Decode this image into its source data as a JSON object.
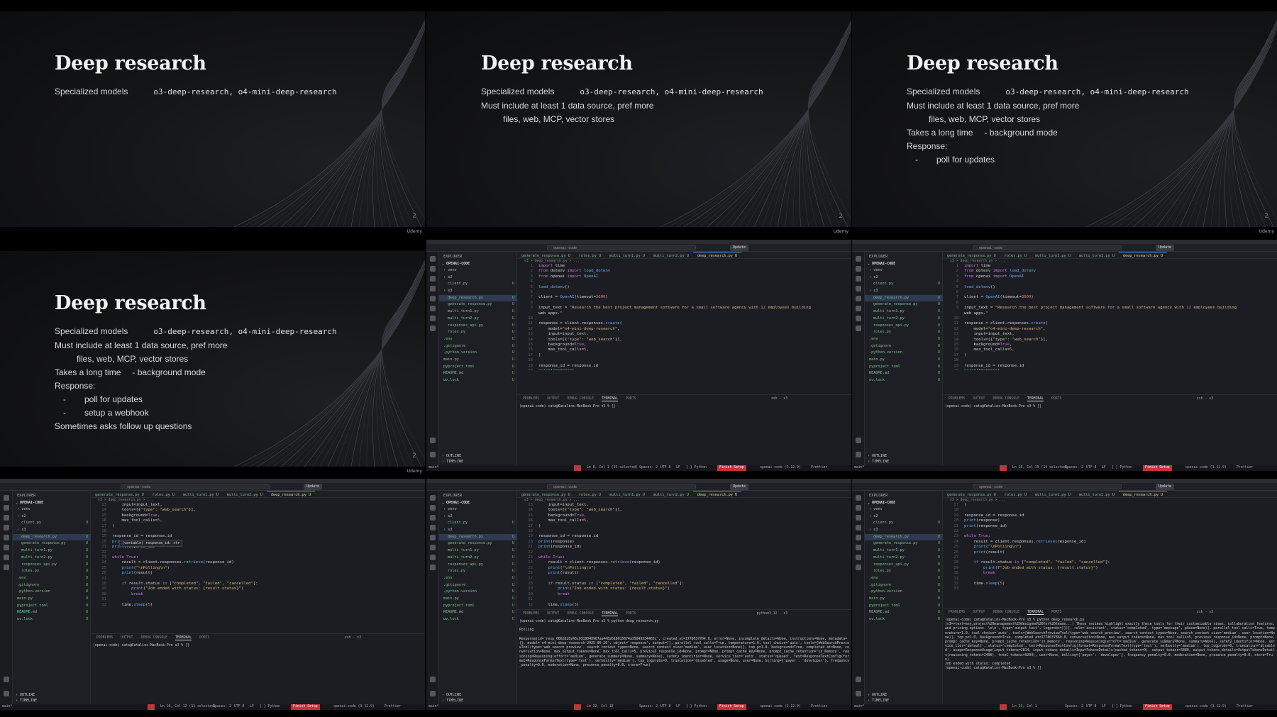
{
  "slides": [
    {
      "title": "Deep research",
      "page_number": "2",
      "brand": "Udemy",
      "lines": [
        {
          "label": "Specialized models",
          "code": "o3-deep-research, o4-mini-deep-research"
        }
      ]
    },
    {
      "title": "Deep research",
      "page_number": "2",
      "brand": "Udemy",
      "lines": [
        {
          "label": "Specialized models",
          "code": "o3-deep-research, o4-mini-deep-research"
        },
        {
          "label": "Must include at least 1 data source, pref more"
        },
        {
          "label": "files, web, MCP, vector stores",
          "indent": true
        }
      ]
    },
    {
      "title": "Deep research",
      "page_number": "2",
      "brand": "Udemy",
      "lines": [
        {
          "label": "Specialized models",
          "code": "o3-deep-research, o4-mini-deep-research"
        },
        {
          "label": "Must include at least 1 data source, pref more"
        },
        {
          "label": "files, web, MCP, vector stores",
          "indent": true
        },
        {
          "label": "Takes a long time",
          "extra": "- background mode"
        },
        {
          "label": "Response:"
        },
        {
          "label": "poll for updates",
          "bullet": true
        }
      ]
    },
    {
      "title": "Deep research",
      "page_number": "2",
      "brand": "Udemy",
      "lines": [
        {
          "label": "Specialized models",
          "code": "o3-deep-research, o4-mini-deep-research"
        },
        {
          "label": "Must include at least 1 data source, pref more"
        },
        {
          "label": "files, web, MCP, vector stores",
          "indent": true
        },
        {
          "label": "Takes a long time",
          "extra": "- background mode"
        },
        {
          "label": "Response:"
        },
        {
          "label": "poll for updates",
          "bullet": true
        },
        {
          "label": "setup a webhook",
          "bullet": true
        },
        {
          "label": "Sometimes asks follow up questions"
        }
      ]
    }
  ],
  "editor": {
    "search_placeholder": "openai-code",
    "update_label": "Update",
    "explorer_label": "EXPLORER",
    "project_label": "OPENAI-CODE",
    "outline_label": "OUTLINE",
    "timeline_label": "TIMELINE",
    "breadcrumb": "s3 > deep_research.py > ...",
    "tabs": [
      "generate_response.py U",
      "roles.py U",
      "multi_turn1.py U",
      "multi_turn2.py U",
      "deep_research.py U"
    ],
    "tree": [
      {
        "name": "venv",
        "depth": 1,
        "u": ""
      },
      {
        "name": "s2",
        "depth": 1,
        "u": ""
      },
      {
        "name": "client.py",
        "depth": 2,
        "u": "U"
      },
      {
        "name": "s3",
        "depth": 1,
        "u": ""
      },
      {
        "name": "deep_research.py",
        "depth": 2,
        "u": "U",
        "selected": true
      },
      {
        "name": "generate_response.py",
        "depth": 2,
        "u": "U"
      },
      {
        "name": "multi_turn1.py",
        "depth": 2,
        "u": "U"
      },
      {
        "name": "multi_turn2.py",
        "depth": 2,
        "u": "U"
      },
      {
        "name": "responses_api.py",
        "depth": 2,
        "u": "U"
      },
      {
        "name": "roles.py",
        "depth": 2,
        "u": "U"
      },
      {
        "name": ".env",
        "depth": 1,
        "u": "U"
      },
      {
        "name": ".gitignore",
        "depth": 1,
        "u": "U"
      },
      {
        "name": ".python-version",
        "depth": 1,
        "u": "U"
      },
      {
        "name": "main.py",
        "depth": 1,
        "u": "U"
      },
      {
        "name": "pyproject.toml",
        "depth": 1,
        "u": "U"
      },
      {
        "name": "README.md",
        "depth": 1,
        "u": "U"
      },
      {
        "name": "uv.lock",
        "depth": 1,
        "u": "U"
      }
    ],
    "panel_tabs": [
      "PROBLEMS",
      "OUTPUT",
      "DEBUG CONSOLE",
      "TERMINAL",
      "PORTS"
    ],
    "prompt": "(openai-code) cata@Catalins-MacBook-Pro s3 % ",
    "status_common": {
      "branch": "main*",
      "spaces": "Spaces: 2",
      "encoding": "UTF-8",
      "eol": "LF",
      "lang": "{ } Python",
      "finish": "Finish Setup",
      "interp": "openai-code (3.12.9)",
      "prettier": "Prettier"
    },
    "code_top": [
      {
        "n": "1",
        "t": "import time"
      },
      {
        "n": "2",
        "t": "from dotenv import load_dotenv"
      },
      {
        "n": "3",
        "t": "from openai import OpenAI"
      },
      {
        "n": "4",
        "t": ""
      },
      {
        "n": "5",
        "t": "load_dotenv()"
      },
      {
        "n": "6",
        "t": ""
      },
      {
        "n": "7",
        "t": "client = OpenAI(timeout=3600)"
      },
      {
        "n": "8",
        "t": ""
      },
      {
        "n": "9",
        "t": "input_text = \"Research the best project management software for a small software agency with 12 employees building"
      },
      {
        "n": "",
        "t": "web apps.\""
      },
      {
        "n": "10",
        "t": ""
      },
      {
        "n": "11",
        "t": "response = client.responses.create("
      },
      {
        "n": "12",
        "t": "    model=\"o4-mini-deep-research\","
      },
      {
        "n": "13",
        "t": "    input=input_text,"
      },
      {
        "n": "14",
        "t": "    tools=[{\"type\": \"web_search\"}],"
      },
      {
        "n": "15",
        "t": "    background=True,"
      },
      {
        "n": "16",
        "t": "    max_tool_calls=5,"
      },
      {
        "n": "17",
        "t": ")"
      },
      {
        "n": "18",
        "t": ""
      },
      {
        "n": "19",
        "t": "response_id = response.id"
      },
      {
        "n": "20",
        "t": "print(response)"
      }
    ],
    "code_mid": [
      {
        "n": "13",
        "t": "    input=input_text,"
      },
      {
        "n": "14",
        "t": "    tools=[{\"type\": \"web_search\"}],"
      },
      {
        "n": "15",
        "t": "    background=True,"
      },
      {
        "n": "16",
        "t": "    max_tool_calls=5,"
      },
      {
        "n": "17",
        "t": ")"
      },
      {
        "n": "18",
        "t": ""
      },
      {
        "n": "19",
        "t": "response_id = response.id"
      },
      {
        "n": "20",
        "t": "print(response)"
      },
      {
        "n": "21",
        "t": "print(response_id)"
      },
      {
        "n": "22",
        "t": ""
      },
      {
        "n": "23",
        "t": "while True:"
      },
      {
        "n": "24",
        "t": "    result = client.responses.retrieve(response_id)"
      },
      {
        "n": "25",
        "t": "    print(\"\\nPolling\\n\")"
      },
      {
        "n": "26",
        "t": "    print(result)"
      },
      {
        "n": "27",
        "t": ""
      },
      {
        "n": "28",
        "t": "    if result.status in [\"completed\", \"failed\", \"cancelled\"]:"
      },
      {
        "n": "29",
        "t": "        print(\"Job ended with status: {result.status}\")"
      },
      {
        "n": "30",
        "t": "        break"
      },
      {
        "n": "31",
        "t": ""
      },
      {
        "n": "32",
        "t": "    time.sleep(5)"
      }
    ],
    "code_end": [
      {
        "n": "17",
        "t": ")"
      },
      {
        "n": "18",
        "t": ""
      },
      {
        "n": "19",
        "t": "response_id = response.id"
      },
      {
        "n": "20",
        "t": "print(response)"
      },
      {
        "n": "21",
        "t": "print(response_id)"
      },
      {
        "n": "22",
        "t": ""
      },
      {
        "n": "23",
        "t": "while True:"
      },
      {
        "n": "24",
        "t": "    result = client.responses.retrieve(response_id)"
      },
      {
        "n": "25",
        "t": "    print(\"\\nPolling\\n\")"
      },
      {
        "n": "26",
        "t": "    print(result)"
      },
      {
        "n": "27",
        "t": ""
      },
      {
        "n": "28",
        "t": "    if result.status in [\"completed\", \"failed\", \"cancelled\"]:"
      },
      {
        "n": "29",
        "t": "        print(f\"Job ended with status: {result.status}\")"
      },
      {
        "n": "30",
        "t": "        break"
      },
      {
        "n": "31",
        "t": ""
      },
      {
        "n": "32",
        "t": "    time.sleep(5)"
      },
      {
        "n": "33",
        "t": ""
      }
    ],
    "hover_tip": "(variable) response_id: str",
    "screens": [
      {
        "cursor": "Ln 8, Col 1 (15 selected)",
        "term_tag": "zsh - s3",
        "terminal": "(openai-code) cata@Catalins-MacBook-Pro s3 % []"
      },
      {
        "cursor": "Ln 16, Col 19 (14 selected)",
        "term_tag": "zsh - s3",
        "terminal": "(openai-code) cata@Catalins-MacBook-Pro s3 % []"
      },
      {
        "cursor": "Ln 10, Col 12 (11 selected)",
        "term_tag": "zsh - s3",
        "terminal": "(openai-code) cata@Catalins-MacBook-Pro s3 % []"
      },
      {
        "cursor": "Ln 32, Col 18",
        "term_tag": "python3.12 - s3",
        "terminal": "(openai-code) cata@Catalins-MacBook-Pro s3 % python deep_research.py\n\nPolling\n\nResponse(id='resp_0862820243c9319048907aa4482618015674a35049334465c', created_at=1778037704.0, error=None, incomplete_details=None, instructions=None, metadata={}, model='o4-mini-deep-research-2025-06-26', object='response', output=[], parallel_tool_calls=True, temperature=1.0, tool_choice='auto', tools=[WebSearchPreviewTool(type='web_search_preview', search_context_types=None, search_context_size='medium', user_location=None)], top_p=1.0, background=True, completed_at=None, conversation=None, max_output_tokens=None, max_tool_calls=5, previous_response_id=None, prompt=None, prompt_cache_key=None, prompt_cache_retention='in_memory', reasoning=Reasoning(effort='medium', generate_summary=None, summary=None), safety_identifier=None, service_tier='auto', status='queued', text=ResponseTextConfig(format=ResponseFormatText(type='text'), verbosity='medium'), top_logprobs=0, truncation='disabled', usage=None, user=None, billing={'payer': 'developer'}, frequency_penalty=0.0, moderation=None, presence_penalty=0.0, store=True)"
      },
      {
        "cursor": "Ln 33, Col 1",
        "term_tag": "zsh - s3",
        "terminal": "(openai-code) cata@Catalins-MacBook-Pro s3 % python deep_research.py\n(s3=>text=any,project%20management%20designed%20for%20teams...) These reviews highlight exactly these tools for their customizable views, collaboration features, and pricing options. \\n\\n', type='output_text', logprobs=[])], role='assistant', status='completed', type='message', phase=None)], parallel_tool_calls=True, temperature=1.0, tool_choice='auto', tools=[WebSearchPreviewTool(type='web_search_preview', search_context_types=None, search_context_size='medium', user_location=None)], top_p=1.0, background=True, completed_at=1778037860.0, conversation=None, max_output_tokens=None, max_tool_calls=5, previous_response_id=None, prompt=None, prompt_cache_key=None, prompt_cache_retention='in_memory', reasoning=Reasoning(effort='medium', generate_summary=None, summary=None), safety_identifier=None, service_tier='default', status='completed', text=ResponseTextConfig(format=ResponseFormatText(type='text'), verbosity='medium'), top_logprobs=0, truncation='disabled', usage=ResponseUsage(input_tokens=2814, input_tokens_details=InputTokensDetails(cached_tokens=0), output_tokens=3480, output_tokens_details=OutputTokensDetails(reasoning_tokens=2496), total_tokens=6294), user=None, billing={'payer': 'developer'}, frequency_penalty=0.0, moderation=None, presence_penalty=0.0, store=True)\nJob ended with status: completed\n(openai-code) cata@Catalins-MacBook-Pro s3 % []"
      }
    ]
  },
  "colors": {
    "accent_green": "#7fc08e",
    "status_red": "#c2333d",
    "selection_blue": "#2d3a52"
  }
}
